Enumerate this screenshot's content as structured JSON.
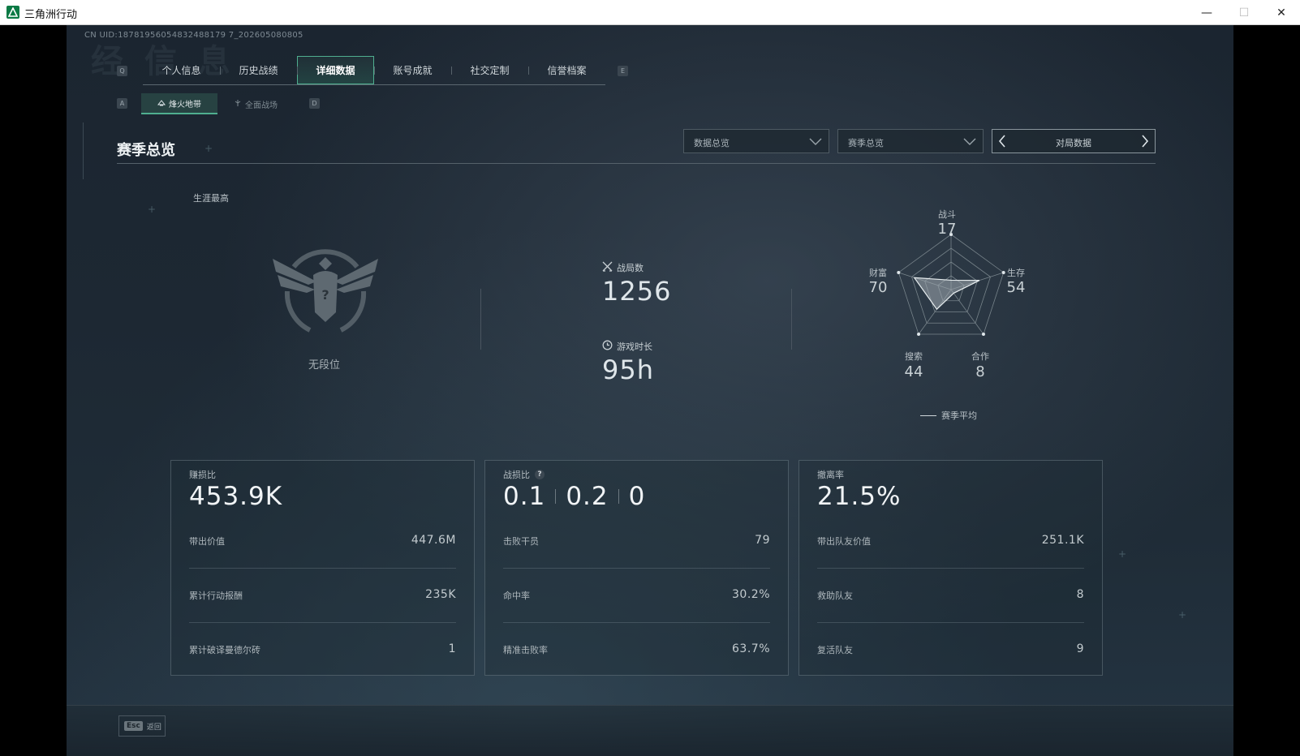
{
  "window": {
    "title": "三角洲行动",
    "minimize": "—",
    "maximize": "☐",
    "close": "✕"
  },
  "uid": "CN UID:18781956054832488179 7_202605080805",
  "ghost_title": "经 信 息",
  "keyhints": {
    "left_tab": "Q",
    "right_tab": "E",
    "left_sub": "A",
    "right_sub": "D"
  },
  "tabs": [
    {
      "label": "个人信息",
      "active": false
    },
    {
      "label": "历史战绩",
      "active": false
    },
    {
      "label": "详细数据",
      "active": true
    },
    {
      "label": "账号成就",
      "active": false
    },
    {
      "label": "社交定制",
      "active": false
    },
    {
      "label": "信誉档案",
      "active": false
    }
  ],
  "subtabs": [
    {
      "label": "烽火地带",
      "icon": "fire-zone-icon",
      "active": true
    },
    {
      "label": "全面战场",
      "icon": "battlefield-icon",
      "active": false
    }
  ],
  "section": {
    "title": "赛季总览"
  },
  "dropdowns": [
    {
      "label": "数据总览"
    },
    {
      "label": "赛季总览"
    }
  ],
  "pager": {
    "label": "对局数据"
  },
  "career": {
    "label": "生涯最高",
    "rank": "无段位",
    "emblem_mark": "?"
  },
  "stats": {
    "matches": {
      "label": "战局数",
      "value": "1256",
      "icon": "crossed-swords-icon"
    },
    "playtime": {
      "label": "游戏时长",
      "value": "95h",
      "icon": "clock-icon"
    }
  },
  "radar": {
    "axes": [
      {
        "label": "战斗",
        "value": "17"
      },
      {
        "label": "生存",
        "value": "54"
      },
      {
        "label": "合作",
        "value": "8"
      },
      {
        "label": "搜索",
        "value": "44"
      },
      {
        "label": "财富",
        "value": "70"
      }
    ],
    "legend": "赛季平均"
  },
  "cards": [
    {
      "title": "赚损比",
      "big": [
        "453.9K"
      ],
      "rows": [
        {
          "label": "带出价值",
          "value": "447.6M"
        },
        {
          "label": "累计行动报酬",
          "value": "235K"
        },
        {
          "label": "累计破译曼德尔砖",
          "value": "1"
        }
      ]
    },
    {
      "title": "战损比",
      "has_help": true,
      "help": "?",
      "big": [
        "0.1",
        "0.2",
        "0"
      ],
      "rows": [
        {
          "label": "击败干员",
          "value": "79"
        },
        {
          "label": "命中率",
          "value": "30.2%"
        },
        {
          "label": "精准击败率",
          "value": "63.7%"
        }
      ]
    },
    {
      "title": "撤离率",
      "big": [
        "21.5%"
      ],
      "rows": [
        {
          "label": "带出队友价值",
          "value": "251.1K"
        },
        {
          "label": "救助队友",
          "value": "8"
        },
        {
          "label": "复活队友",
          "value": "9"
        }
      ]
    }
  ],
  "back": {
    "key": "Esc",
    "label": "返回"
  },
  "colors": {
    "accent": "#4fae8f",
    "text": "#dfe6ea",
    "panel_border": "#55616a"
  }
}
